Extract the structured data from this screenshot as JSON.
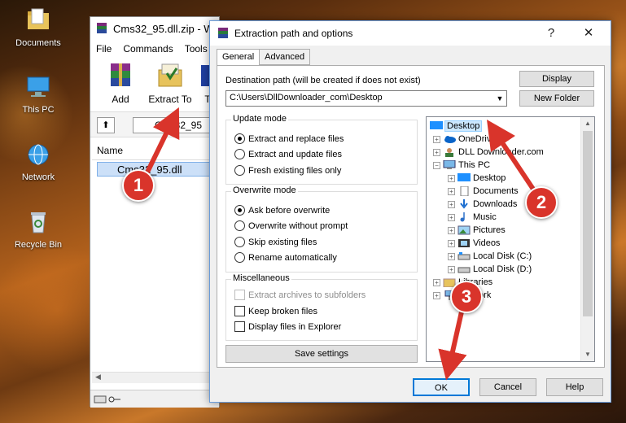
{
  "desktop": {
    "icons": [
      {
        "label": "Documents",
        "icon": "folder-documents-icon"
      },
      {
        "label": "This PC",
        "icon": "computer-icon"
      },
      {
        "label": "Network",
        "icon": "network-icon"
      },
      {
        "label": "Recycle Bin",
        "icon": "recycle-bin-icon"
      }
    ]
  },
  "winrar": {
    "title": "Cms32_95.dll.zip - W",
    "menu": [
      "File",
      "Commands",
      "Tools"
    ],
    "toolbar": {
      "add": "Add",
      "extract_to": "Extract To",
      "third": "T"
    },
    "path_text": "Cms32_95",
    "column_name": "Name",
    "file_name": "Cms32_95.dll"
  },
  "dialog": {
    "title": "Extraction path and options",
    "help": "?",
    "close": "✕",
    "tabs": [
      "General",
      "Advanced"
    ],
    "destination_label": "Destination path (will be created if does not exist)",
    "destination_value": "C:\\Users\\DllDownloader_com\\Desktop",
    "display_button": "Display",
    "new_folder_button": "New Folder",
    "update_mode": {
      "title": "Update mode",
      "options": [
        "Extract and replace files",
        "Extract and update files",
        "Fresh existing files only"
      ],
      "selected": 0
    },
    "overwrite_mode": {
      "title": "Overwrite mode",
      "options": [
        "Ask before overwrite",
        "Overwrite without prompt",
        "Skip existing files",
        "Rename automatically"
      ],
      "selected": 0
    },
    "misc": {
      "title": "Miscellaneous",
      "options": [
        "Extract archives to subfolders",
        "Keep broken files",
        "Display files in Explorer"
      ]
    },
    "save_settings": "Save settings",
    "tree": [
      {
        "label": "Desktop",
        "selected": true
      },
      {
        "label": "OneDrive"
      },
      {
        "label": "DLL Downloader.com"
      },
      {
        "label": "This PC"
      },
      {
        "label": "Desktop"
      },
      {
        "label": "Documents"
      },
      {
        "label": "Downloads"
      },
      {
        "label": "Music"
      },
      {
        "label": "Pictures"
      },
      {
        "label": "Videos"
      },
      {
        "label": "Local Disk (C:)"
      },
      {
        "label": "Local Disk (D:)"
      },
      {
        "label": "Libraries"
      },
      {
        "label": "Network"
      }
    ],
    "ok": "OK",
    "cancel": "Cancel",
    "help_button": "Help"
  },
  "annotations": [
    "1",
    "2",
    "3"
  ],
  "colors": {
    "annotation": "#d9342b",
    "selection": "#cce8ff",
    "accent": "#0078d7"
  }
}
